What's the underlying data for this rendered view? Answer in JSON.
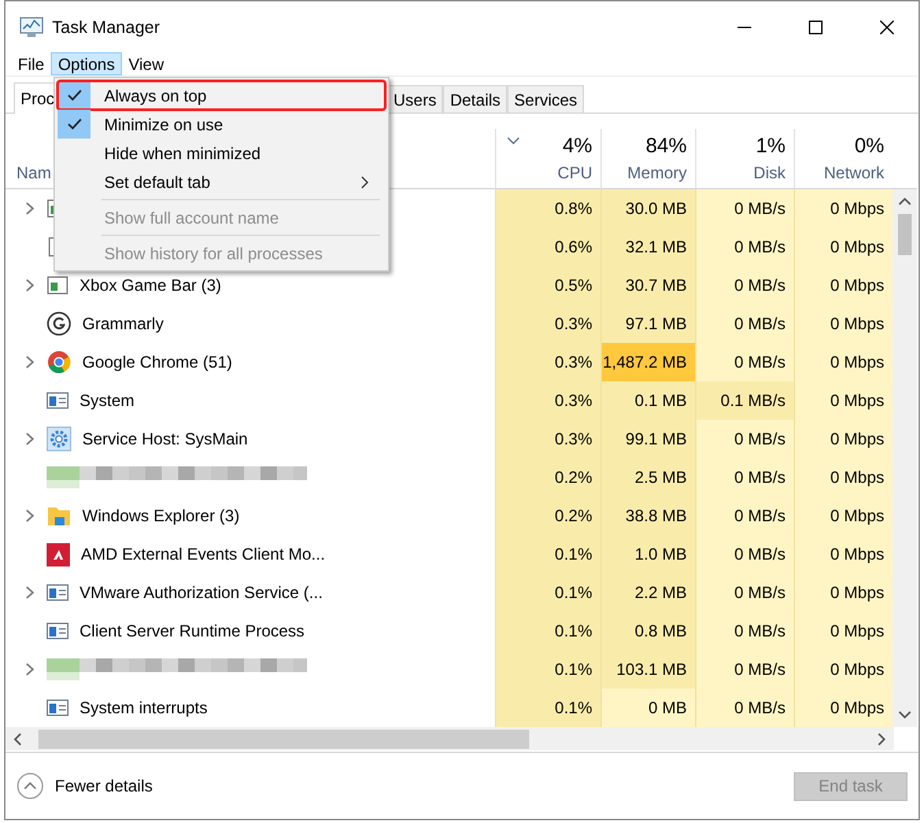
{
  "window": {
    "title": "Task Manager"
  },
  "menu_bar": [
    {
      "label": "File",
      "selected": false
    },
    {
      "label": "Options",
      "selected": true
    },
    {
      "label": "View",
      "selected": false
    }
  ],
  "options_menu": [
    {
      "kind": "item",
      "label": "Always on top",
      "checked": true,
      "disabled": false,
      "highlighted": true
    },
    {
      "kind": "item",
      "label": "Minimize on use",
      "checked": true,
      "disabled": false,
      "highlighted": false
    },
    {
      "kind": "item",
      "label": "Hide when minimized",
      "checked": false,
      "disabled": false,
      "highlighted": false
    },
    {
      "kind": "submenu",
      "label": "Set default tab",
      "checked": false,
      "disabled": false,
      "highlighted": false
    },
    {
      "kind": "separator"
    },
    {
      "kind": "item",
      "label": "Show full account name",
      "checked": false,
      "disabled": true,
      "highlighted": false
    },
    {
      "kind": "separator"
    },
    {
      "kind": "item",
      "label": "Show history for all processes",
      "checked": false,
      "disabled": true,
      "highlighted": false
    }
  ],
  "tabs": [
    {
      "label": "Proc",
      "selected": true
    },
    {
      "label": "Users",
      "selected": false
    },
    {
      "label": "Details",
      "selected": false
    },
    {
      "label": "Services",
      "selected": false
    }
  ],
  "table": {
    "name_column": "Nam",
    "columns": [
      {
        "value": "4%",
        "label": "CPU",
        "sorted": true
      },
      {
        "value": "84%",
        "label": "Memory",
        "sorted": false
      },
      {
        "value": "1%",
        "label": "Disk",
        "sorted": false
      },
      {
        "value": "0%",
        "label": "Network",
        "sorted": false
      }
    ],
    "rows": [
      {
        "kind": "app",
        "expandable": true,
        "cells": [
          {
            "text": "0.8%",
            "color": "#f9ecab"
          },
          {
            "text": "30.0 MB",
            "color": "#f9ecab"
          },
          {
            "text": "0 MB/s",
            "color": "#fff4c4"
          },
          {
            "text": "0 Mbps",
            "color": "#fff4c4"
          }
        ]
      },
      {
        "kind": "blank",
        "expandable": false,
        "cells": [
          {
            "text": "0.6%",
            "color": "#f9ecab"
          },
          {
            "text": "32.1 MB",
            "color": "#f9ecab"
          },
          {
            "text": "0 MB/s",
            "color": "#fff4c4"
          },
          {
            "text": "0 Mbps",
            "color": "#fff4c4"
          }
        ]
      },
      {
        "kind": "app",
        "expandable": true,
        "name": "Xbox Game Bar (3)",
        "cells": [
          {
            "text": "0.5%",
            "color": "#f9ecab"
          },
          {
            "text": "30.7 MB",
            "color": "#f9ecab"
          },
          {
            "text": "0 MB/s",
            "color": "#fff4c4"
          },
          {
            "text": "0 Mbps",
            "color": "#fff4c4"
          }
        ]
      },
      {
        "kind": "grammarly",
        "expandable": false,
        "name": "Grammarly",
        "cells": [
          {
            "text": "0.3%",
            "color": "#f9ecab"
          },
          {
            "text": "97.1 MB",
            "color": "#f9ecab"
          },
          {
            "text": "0 MB/s",
            "color": "#fff4c4"
          },
          {
            "text": "0 Mbps",
            "color": "#fff4c4"
          }
        ]
      },
      {
        "kind": "chrome",
        "expandable": true,
        "name": "Google Chrome (51)",
        "cells": [
          {
            "text": "0.3%",
            "color": "#f9ecab"
          },
          {
            "text": "1,487.2 MB",
            "color": "#ffc83d"
          },
          {
            "text": "0 MB/s",
            "color": "#fff4c4"
          },
          {
            "text": "0 Mbps",
            "color": "#fff4c4"
          }
        ]
      },
      {
        "kind": "window",
        "expandable": false,
        "name": "System",
        "cells": [
          {
            "text": "0.3%",
            "color": "#f9ecab"
          },
          {
            "text": "0.1 MB",
            "color": "#f9ecab"
          },
          {
            "text": "0.1 MB/s",
            "color": "#f9ecab"
          },
          {
            "text": "0 Mbps",
            "color": "#fff4c4"
          }
        ]
      },
      {
        "kind": "gear",
        "expandable": true,
        "name": "Service Host: SysMain",
        "cells": [
          {
            "text": "0.3%",
            "color": "#f9ecab"
          },
          {
            "text": "99.1 MB",
            "color": "#f9ecab"
          },
          {
            "text": "0 MB/s",
            "color": "#fff4c4"
          },
          {
            "text": "0 Mbps",
            "color": "#fff4c4"
          }
        ]
      },
      {
        "kind": "redacted",
        "expandable": false,
        "cells": [
          {
            "text": "0.2%",
            "color": "#f9ecab"
          },
          {
            "text": "2.5 MB",
            "color": "#f9ecab"
          },
          {
            "text": "0 MB/s",
            "color": "#fff4c4"
          },
          {
            "text": "0 Mbps",
            "color": "#fff4c4"
          }
        ]
      },
      {
        "kind": "folder",
        "expandable": true,
        "name": "Windows Explorer (3)",
        "cells": [
          {
            "text": "0.2%",
            "color": "#f9ecab"
          },
          {
            "text": "38.8 MB",
            "color": "#f9ecab"
          },
          {
            "text": "0 MB/s",
            "color": "#fff4c4"
          },
          {
            "text": "0 Mbps",
            "color": "#fff4c4"
          }
        ]
      },
      {
        "kind": "amd",
        "expandable": false,
        "name": "AMD External Events Client Mo...",
        "cells": [
          {
            "text": "0.1%",
            "color": "#f9ecab"
          },
          {
            "text": "1.0 MB",
            "color": "#f9ecab"
          },
          {
            "text": "0 MB/s",
            "color": "#fff4c4"
          },
          {
            "text": "0 Mbps",
            "color": "#fff4c4"
          }
        ]
      },
      {
        "kind": "window",
        "expandable": true,
        "name": "VMware Authorization Service (...",
        "cells": [
          {
            "text": "0.1%",
            "color": "#f9ecab"
          },
          {
            "text": "2.2 MB",
            "color": "#f9ecab"
          },
          {
            "text": "0 MB/s",
            "color": "#fff4c4"
          },
          {
            "text": "0 Mbps",
            "color": "#fff4c4"
          }
        ]
      },
      {
        "kind": "window",
        "expandable": false,
        "name": "Client Server Runtime Process",
        "cells": [
          {
            "text": "0.1%",
            "color": "#f9ecab"
          },
          {
            "text": "0.8 MB",
            "color": "#f9ecab"
          },
          {
            "text": "0 MB/s",
            "color": "#fff4c4"
          },
          {
            "text": "0 Mbps",
            "color": "#fff4c4"
          }
        ]
      },
      {
        "kind": "redacted",
        "expandable": true,
        "cells": [
          {
            "text": "0.1%",
            "color": "#f9ecab"
          },
          {
            "text": "103.1 MB",
            "color": "#f9ecab"
          },
          {
            "text": "0 MB/s",
            "color": "#fff4c4"
          },
          {
            "text": "0 Mbps",
            "color": "#fff4c4"
          }
        ]
      },
      {
        "kind": "window",
        "expandable": false,
        "name": "System interrupts",
        "cells": [
          {
            "text": "0.1%",
            "color": "#f9ecab"
          },
          {
            "text": "0 MB",
            "color": "#fff4c4"
          },
          {
            "text": "0 MB/s",
            "color": "#fff4c4"
          },
          {
            "text": "0 Mbps",
            "color": "#fff4c4"
          }
        ]
      }
    ]
  },
  "footer": {
    "details_link": "Fewer details",
    "end_task": {
      "label": "End task",
      "disabled": true
    }
  }
}
